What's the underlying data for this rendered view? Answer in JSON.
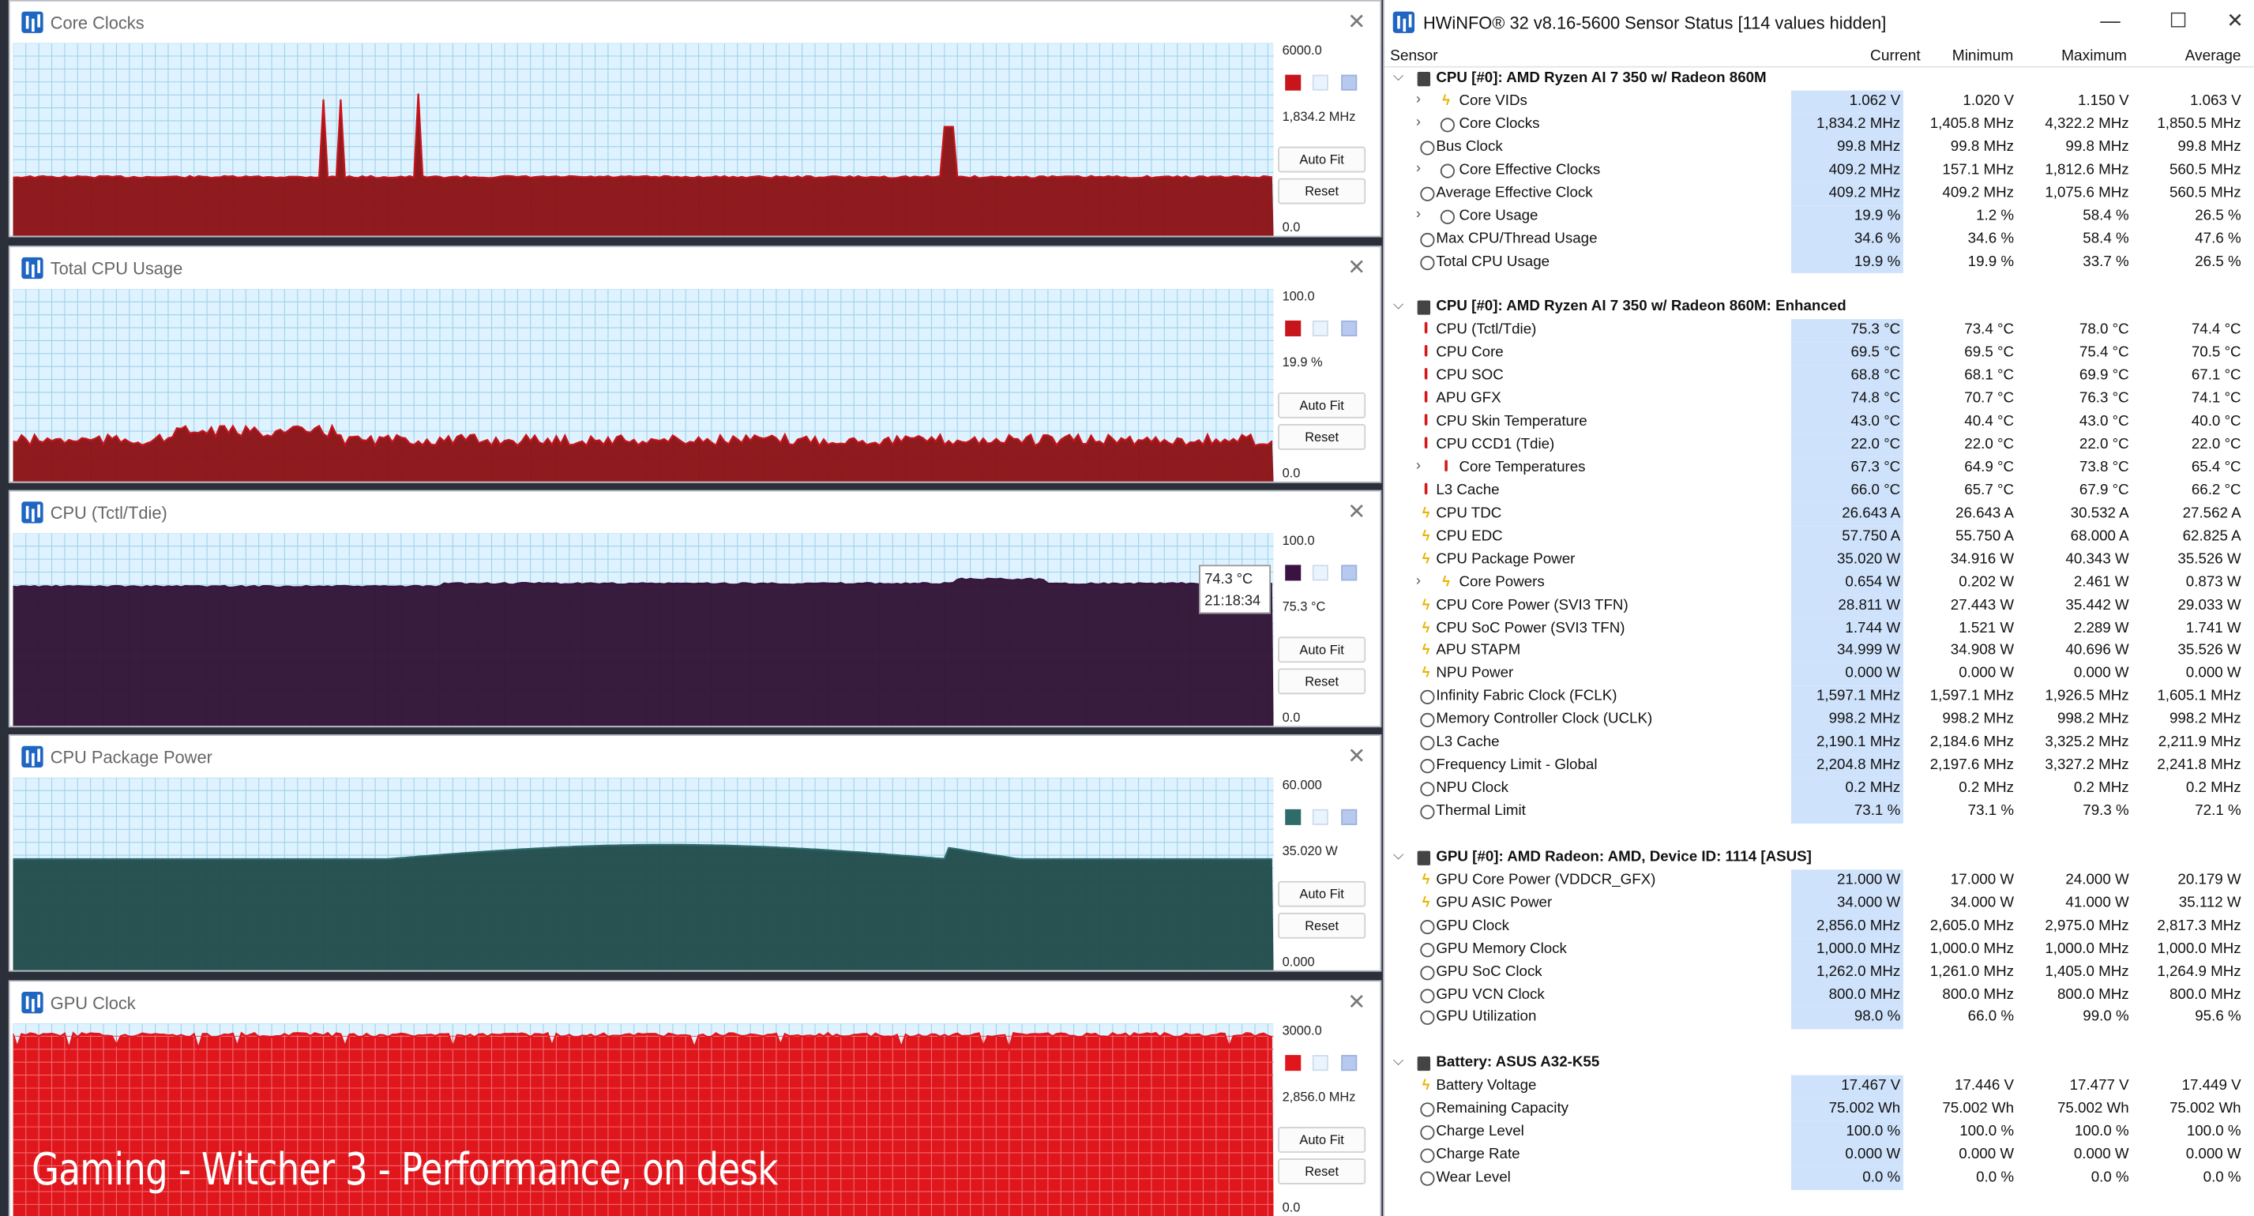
{
  "overlay_caption": "Gaming - Witcher 3 - Performance, on desk",
  "buttons": {
    "autofit": "Auto Fit",
    "reset": "Reset"
  },
  "graphs": [
    {
      "title": "Core Clocks",
      "max": "6000.0",
      "current": "1,834.2 MHz",
      "min": "0.0",
      "color": "#c8141b",
      "fill": "#8a0f12",
      "level": 0.31
    },
    {
      "title": "Total CPU Usage",
      "max": "100.0",
      "current": "19.9 %",
      "min": "0.0",
      "color": "#c8141b",
      "fill": "#8a0f12",
      "level": 0.22
    },
    {
      "title": "CPU (Tctl/Tdie)",
      "max": "100.0",
      "current": "75.3 °C",
      "min": "0.0",
      "color": "#3a1440",
      "fill": "#2e1033",
      "level": 0.74
    },
    {
      "title": "CPU Package Power",
      "max": "60.000",
      "current": "35.020 W",
      "min": "0.000",
      "color": "#2e6b6b",
      "fill": "#1f4a4a",
      "level": 0.58
    },
    {
      "title": "GPU Clock",
      "max": "3000.0",
      "current": "2,856.0 MHz",
      "min": "0.0",
      "color": "#e0161d",
      "fill": "#e0161d",
      "level": 0.94
    }
  ],
  "tooltip": {
    "value": "74.3 °C",
    "time": "21:18:34"
  },
  "hwinfo": {
    "title": "HWiNFO® 32 v8.16-5600 Sensor Status [114 values hidden]",
    "window_buttons": [
      "—",
      "☐",
      "✕"
    ],
    "columns": [
      "Sensor",
      "Current",
      "Minimum",
      "Maximum",
      "Average"
    ],
    "rows": [
      {
        "type": "group",
        "name": "CPU [#0]: AMD Ryzen AI 7 350 w/ Radeon 860M"
      },
      {
        "type": "row",
        "icon": "bolt",
        "expand": true,
        "name": "Core VIDs",
        "cur": "1.062 V",
        "min": "1.020 V",
        "max": "1.150 V",
        "avg": "1.063 V"
      },
      {
        "type": "row",
        "icon": "clock",
        "expand": true,
        "name": "Core Clocks",
        "cur": "1,834.2 MHz",
        "min": "1,405.8 MHz",
        "max": "4,322.2 MHz",
        "avg": "1,850.5 MHz"
      },
      {
        "type": "row",
        "icon": "clock",
        "name": "Bus Clock",
        "cur": "99.8 MHz",
        "min": "99.8 MHz",
        "max": "99.8 MHz",
        "avg": "99.8 MHz"
      },
      {
        "type": "row",
        "icon": "clock",
        "expand": true,
        "name": "Core Effective Clocks",
        "cur": "409.2 MHz",
        "min": "157.1 MHz",
        "max": "1,812.6 MHz",
        "avg": "560.5 MHz"
      },
      {
        "type": "row",
        "icon": "clock",
        "name": "Average Effective Clock",
        "cur": "409.2 MHz",
        "min": "409.2 MHz",
        "max": "1,075.6 MHz",
        "avg": "560.5 MHz"
      },
      {
        "type": "row",
        "icon": "pct",
        "expand": true,
        "name": "Core Usage",
        "cur": "19.9 %",
        "min": "1.2 %",
        "max": "58.4 %",
        "avg": "26.5 %"
      },
      {
        "type": "row",
        "icon": "pct",
        "name": "Max CPU/Thread Usage",
        "cur": "34.6 %",
        "min": "34.6 %",
        "max": "58.4 %",
        "avg": "47.6 %"
      },
      {
        "type": "row",
        "icon": "pct",
        "name": "Total CPU Usage",
        "cur": "19.9 %",
        "min": "19.9 %",
        "max": "33.7 %",
        "avg": "26.5 %"
      },
      {
        "type": "blank"
      },
      {
        "type": "group",
        "name": "CPU [#0]: AMD Ryzen AI 7 350 w/ Radeon 860M: Enhanced"
      },
      {
        "type": "row",
        "icon": "temp",
        "name": "CPU (Tctl/Tdie)",
        "cur": "75.3 °C",
        "min": "73.4 °C",
        "max": "78.0 °C",
        "avg": "74.4 °C"
      },
      {
        "type": "row",
        "icon": "temp",
        "name": "CPU Core",
        "cur": "69.5 °C",
        "min": "69.5 °C",
        "max": "75.4 °C",
        "avg": "70.5 °C"
      },
      {
        "type": "row",
        "icon": "temp",
        "name": "CPU SOC",
        "cur": "68.8 °C",
        "min": "68.1 °C",
        "max": "69.9 °C",
        "avg": "67.1 °C"
      },
      {
        "type": "row",
        "icon": "temp",
        "name": "APU GFX",
        "cur": "74.8 °C",
        "min": "70.7 °C",
        "max": "76.3 °C",
        "avg": "74.1 °C"
      },
      {
        "type": "row",
        "icon": "temp",
        "name": "CPU Skin Temperature",
        "cur": "43.0 °C",
        "min": "40.4 °C",
        "max": "43.0 °C",
        "avg": "40.0 °C"
      },
      {
        "type": "row",
        "icon": "temp",
        "name": "CPU CCD1 (Tdie)",
        "cur": "22.0 °C",
        "min": "22.0 °C",
        "max": "22.0 °C",
        "avg": "22.0 °C"
      },
      {
        "type": "row",
        "icon": "temp",
        "expand": true,
        "name": "Core Temperatures",
        "cur": "67.3 °C",
        "min": "64.9 °C",
        "max": "73.8 °C",
        "avg": "65.4 °C"
      },
      {
        "type": "row",
        "icon": "temp",
        "name": "L3 Cache",
        "cur": "66.0 °C",
        "min": "65.7 °C",
        "max": "67.9 °C",
        "avg": "66.2 °C"
      },
      {
        "type": "row",
        "icon": "bolt",
        "name": "CPU TDC",
        "cur": "26.643 A",
        "min": "26.643 A",
        "max": "30.532 A",
        "avg": "27.562 A"
      },
      {
        "type": "row",
        "icon": "bolt",
        "name": "CPU EDC",
        "cur": "57.750 A",
        "min": "55.750 A",
        "max": "68.000 A",
        "avg": "62.825 A"
      },
      {
        "type": "row",
        "icon": "bolt",
        "name": "CPU Package Power",
        "cur": "35.020 W",
        "min": "34.916 W",
        "max": "40.343 W",
        "avg": "35.526 W"
      },
      {
        "type": "row",
        "icon": "bolt",
        "expand": true,
        "name": "Core Powers",
        "cur": "0.654 W",
        "min": "0.202 W",
        "max": "2.461 W",
        "avg": "0.873 W"
      },
      {
        "type": "row",
        "icon": "bolt",
        "name": "CPU Core Power (SVI3 TFN)",
        "cur": "28.811 W",
        "min": "27.443 W",
        "max": "35.442 W",
        "avg": "29.033 W"
      },
      {
        "type": "row",
        "icon": "bolt",
        "name": "CPU SoC Power (SVI3 TFN)",
        "cur": "1.744 W",
        "min": "1.521 W",
        "max": "2.289 W",
        "avg": "1.741 W"
      },
      {
        "type": "row",
        "icon": "bolt",
        "name": "APU STAPM",
        "cur": "34.999 W",
        "min": "34.908 W",
        "max": "40.696 W",
        "avg": "35.526 W"
      },
      {
        "type": "row",
        "icon": "bolt",
        "name": "NPU Power",
        "cur": "0.000 W",
        "min": "0.000 W",
        "max": "0.000 W",
        "avg": "0.000 W"
      },
      {
        "type": "row",
        "icon": "clock",
        "name": "Infinity Fabric Clock (FCLK)",
        "cur": "1,597.1 MHz",
        "min": "1,597.1 MHz",
        "max": "1,926.5 MHz",
        "avg": "1,605.1 MHz"
      },
      {
        "type": "row",
        "icon": "clock",
        "name": "Memory Controller Clock (UCLK)",
        "cur": "998.2 MHz",
        "min": "998.2 MHz",
        "max": "998.2 MHz",
        "avg": "998.2 MHz"
      },
      {
        "type": "row",
        "icon": "clock",
        "name": "L3 Cache",
        "cur": "2,190.1 MHz",
        "min": "2,184.6 MHz",
        "max": "3,325.2 MHz",
        "avg": "2,211.9 MHz"
      },
      {
        "type": "row",
        "icon": "clock",
        "name": "Frequency Limit - Global",
        "cur": "2,204.8 MHz",
        "min": "2,197.6 MHz",
        "max": "3,327.2 MHz",
        "avg": "2,241.8 MHz"
      },
      {
        "type": "row",
        "icon": "clock",
        "name": "NPU Clock",
        "cur": "0.2 MHz",
        "min": "0.2 MHz",
        "max": "0.2 MHz",
        "avg": "0.2 MHz"
      },
      {
        "type": "row",
        "icon": "pct",
        "name": "Thermal Limit",
        "cur": "73.1 %",
        "min": "73.1 %",
        "max": "79.3 %",
        "avg": "72.1 %"
      },
      {
        "type": "blank"
      },
      {
        "type": "group",
        "name": "GPU [#0]: AMD Radeon: AMD, Device ID: 1114 [ASUS]"
      },
      {
        "type": "row",
        "icon": "bolt",
        "name": "GPU Core Power (VDDCR_GFX)",
        "cur": "21.000 W",
        "min": "17.000 W",
        "max": "24.000 W",
        "avg": "20.179 W"
      },
      {
        "type": "row",
        "icon": "bolt",
        "name": "GPU ASIC Power",
        "cur": "34.000 W",
        "min": "34.000 W",
        "max": "41.000 W",
        "avg": "35.112 W"
      },
      {
        "type": "row",
        "icon": "clock",
        "name": "GPU Clock",
        "cur": "2,856.0 MHz",
        "min": "2,605.0 MHz",
        "max": "2,975.0 MHz",
        "avg": "2,817.3 MHz"
      },
      {
        "type": "row",
        "icon": "clock",
        "name": "GPU Memory Clock",
        "cur": "1,000.0 MHz",
        "min": "1,000.0 MHz",
        "max": "1,000.0 MHz",
        "avg": "1,000.0 MHz"
      },
      {
        "type": "row",
        "icon": "clock",
        "name": "GPU SoC Clock",
        "cur": "1,262.0 MHz",
        "min": "1,261.0 MHz",
        "max": "1,405.0 MHz",
        "avg": "1,264.9 MHz"
      },
      {
        "type": "row",
        "icon": "clock",
        "name": "GPU VCN Clock",
        "cur": "800.0 MHz",
        "min": "800.0 MHz",
        "max": "800.0 MHz",
        "avg": "800.0 MHz"
      },
      {
        "type": "row",
        "icon": "pct",
        "name": "GPU Utilization",
        "cur": "98.0 %",
        "min": "66.0 %",
        "max": "99.0 %",
        "avg": "95.6 %"
      },
      {
        "type": "blank"
      },
      {
        "type": "group",
        "name": "Battery: ASUS  A32-K55"
      },
      {
        "type": "row",
        "icon": "bolt",
        "name": "Battery Voltage",
        "cur": "17.467 V",
        "min": "17.446 V",
        "max": "17.477 V",
        "avg": "17.449 V"
      },
      {
        "type": "row",
        "icon": "clock",
        "name": "Remaining Capacity",
        "cur": "75.002 Wh",
        "min": "75.002 Wh",
        "max": "75.002 Wh",
        "avg": "75.002 Wh"
      },
      {
        "type": "row",
        "icon": "clock",
        "name": "Charge Level",
        "cur": "100.0 %",
        "min": "100.0 %",
        "max": "100.0 %",
        "avg": "100.0 %"
      },
      {
        "type": "row",
        "icon": "clock",
        "name": "Charge Rate",
        "cur": "0.000 W",
        "min": "0.000 W",
        "max": "0.000 W",
        "avg": "0.000 W"
      },
      {
        "type": "row",
        "icon": "clock",
        "name": "Wear Level",
        "cur": "0.0 %",
        "min": "0.0 %",
        "max": "0.0 %",
        "avg": "0.0 %"
      }
    ]
  }
}
